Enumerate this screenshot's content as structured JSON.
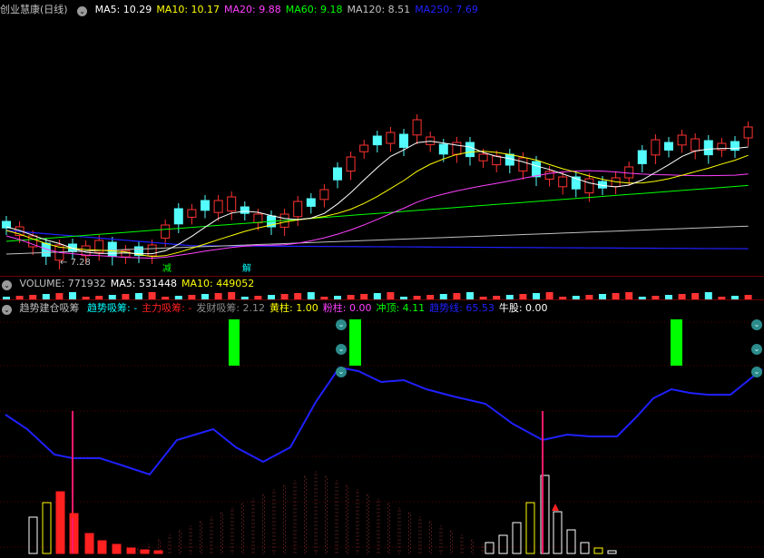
{
  "price_panel": {
    "title": "创业慧康(日线)",
    "ma": [
      {
        "label": "MA5: 10.29",
        "color": "#ffffff"
      },
      {
        "label": "MA10: 10.17",
        "color": "#ffff00"
      },
      {
        "label": "MA20: 9.88",
        "color": "#ff40ff"
      },
      {
        "label": "MA60: 9.18",
        "color": "#00ff00"
      },
      {
        "label": "MA120: 8.51",
        "color": "#c0c0c0"
      },
      {
        "label": "MA250: 7.69",
        "color": "#2020ff"
      }
    ],
    "low_label": "7.28",
    "signals": [
      {
        "text": "减",
        "color": "#00ff00"
      },
      {
        "text": "解",
        "color": "#00ffff"
      }
    ]
  },
  "volume_panel": {
    "items": [
      {
        "label": "VOLUME: 771932",
        "color": "#c0c0c0"
      },
      {
        "label": "MA5: 531448",
        "color": "#ffffff"
      },
      {
        "label": "MA10: 449052",
        "color": "#ffff00"
      }
    ]
  },
  "indicator_panel": {
    "name": "趋势建仓吸筹",
    "items": [
      {
        "label": "趋势吸筹: -",
        "color": "#00ffff"
      },
      {
        "label": "主力吸筹: -",
        "color": "#ff2020"
      },
      {
        "label": "发财吸筹: 2.12",
        "color": "#8c8c8c"
      },
      {
        "label": "黄柱: 1.00",
        "color": "#ffff00"
      },
      {
        "label": "粉柱: 0.00",
        "color": "#ff40ff"
      },
      {
        "label": "冲顶: 4.11",
        "color": "#00ff00"
      },
      {
        "label": "趋势线: 65.53",
        "color": "#2020ff"
      },
      {
        "label": "牛股: 0.00",
        "color": "#ffffff"
      }
    ]
  },
  "colors": {
    "up": "#ff3232",
    "down": "#54fcfc",
    "ma5": "#ffffff",
    "ma10": "#ffff00",
    "ma20": "#ff40ff",
    "ma60": "#00ff00",
    "ma120": "#c0c0c0",
    "ma250": "#2020ff",
    "trend": "#2020ff",
    "signal": "#00ff00",
    "spike": "#ff1a6a"
  }
}
